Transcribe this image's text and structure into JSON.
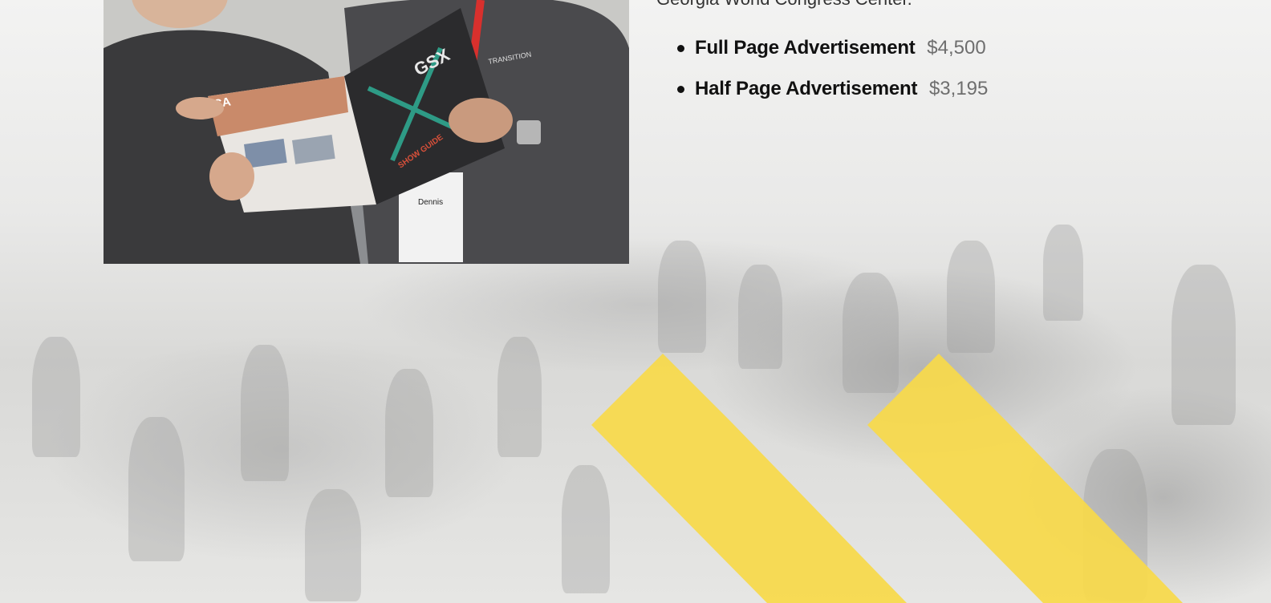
{
  "intro_text": "Georgia World Congress Center.",
  "ads": [
    {
      "name": "Full Page Advertisement",
      "price": "$4,500"
    },
    {
      "name": "Half Page Advertisement",
      "price": "$3,195"
    }
  ],
  "photo": {
    "magazine_cover_text": "GSX",
    "magazine_subtitle": "SHOW GUIDE",
    "ad_page_text": "CA",
    "shirt_logo_text": "TRANSITION",
    "badge_text": "Dennis"
  },
  "colors": {
    "accent_yellow": "#f7d94a",
    "text_dark": "#111111",
    "price_gray": "#6e6e6e"
  }
}
